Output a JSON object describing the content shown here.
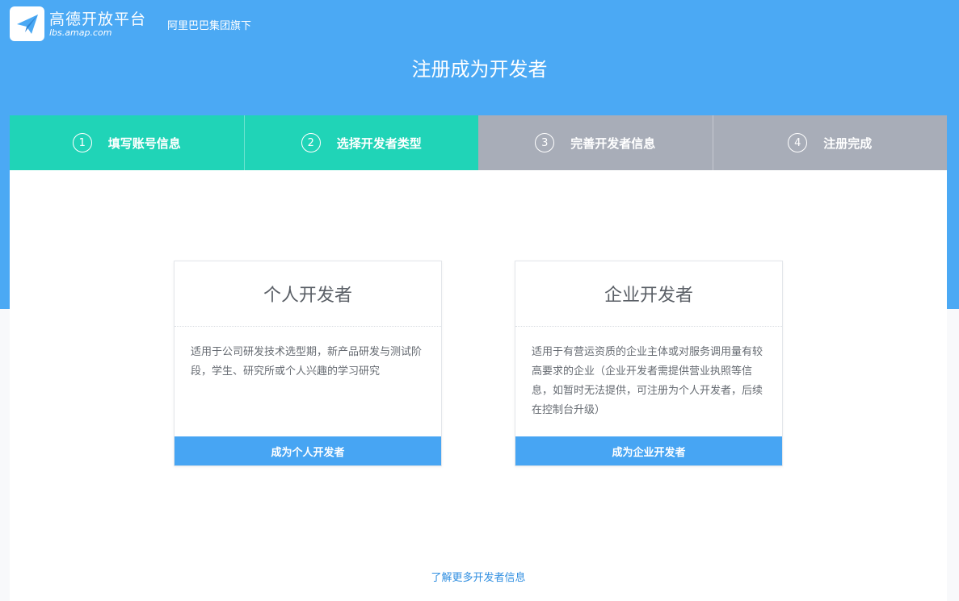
{
  "header": {
    "logo_title": "高德开放平台",
    "logo_subtitle": "lbs.amap.com",
    "group": "阿里巴巴集团旗下",
    "page_title": "注册成为开发者"
  },
  "steps": [
    {
      "num": "1",
      "label": "填写账号信息",
      "state": "done"
    },
    {
      "num": "2",
      "label": "选择开发者类型",
      "state": "current"
    },
    {
      "num": "3",
      "label": "完善开发者信息",
      "state": "pending"
    },
    {
      "num": "4",
      "label": "注册完成",
      "state": "pending"
    }
  ],
  "cards": {
    "personal": {
      "title": "个人开发者",
      "description": "适用于公司研发技术选型期，新产品研发与测试阶段，学生、研究所或个人兴趣的学习研究",
      "button": "成为个人开发者"
    },
    "enterprise": {
      "title": "企业开发者",
      "description": "适用于有营运资质的企业主体或对服务调用量有较高要求的企业（企业开发者需提供营业执照等信息，如暂时无法提供，可注册为个人开发者，后续在控制台升级）",
      "button": "成为企业开发者"
    }
  },
  "footer": {
    "more_link": "了解更多开发者信息"
  },
  "colors": {
    "header_bg": "#4ba9f4",
    "step_active": "#20d4b7",
    "step_inactive": "#a8adb8",
    "button": "#47a5f3",
    "link": "#2f8ee0"
  },
  "icons": {
    "logo": "paper-plane-logo-icon"
  }
}
